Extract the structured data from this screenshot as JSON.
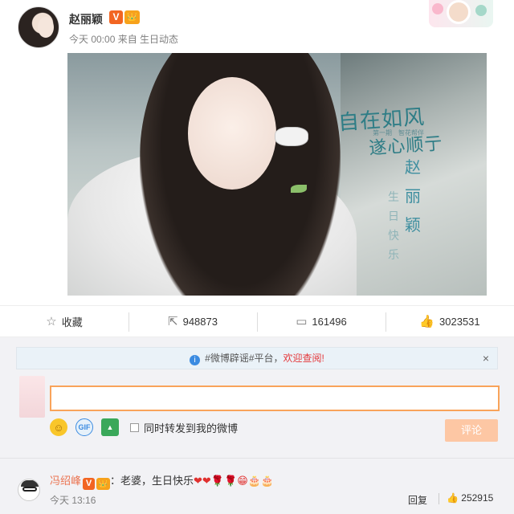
{
  "post": {
    "username": "赵丽颖",
    "verified_badge": "V",
    "vip_badge": "👑",
    "meta": "今天 00:00 来自 生日动态",
    "image": {
      "title_main": "自在如风",
      "title_line2": "遂心顺亍",
      "subtitle": "第一期　智花帮伴",
      "vertical_name": "赵丽颖",
      "vertical_text": "生日快乐"
    }
  },
  "actions": {
    "favorite_label": "收藏",
    "forward_count": "948873",
    "comment_count": "161496",
    "like_count": "3023531"
  },
  "comment_box": {
    "tip_prefix": "#微博辟谣#平台，",
    "tip_highlight": "欢迎查阅!",
    "close_label": "×",
    "input_value": "",
    "forward_label": "同时转发到我的微博",
    "submit_label": "评论"
  },
  "comment": {
    "username": "冯绍峰",
    "verified_badge": "V",
    "vip_badge": "👑",
    "text": "：老婆，生日快乐",
    "emojis": "❤❤🌹🌹😁🎂🎂",
    "time": "今天 13:16",
    "reply_label": "回复",
    "likes": "252915"
  },
  "colors": {
    "accent_orange": "#f26522",
    "input_focus": "#f9a35a",
    "submit_disabled": "#fdc7a4",
    "highlight_red": "#e4393c"
  }
}
